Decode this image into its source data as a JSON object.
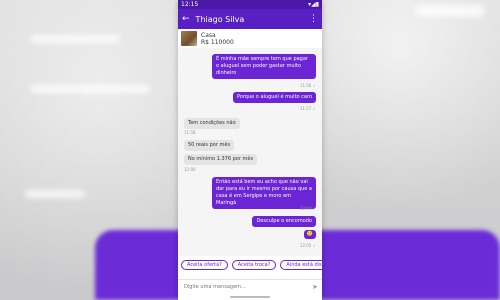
{
  "status": {
    "time": "12:15"
  },
  "header": {
    "contact": "Thiago  Silva"
  },
  "listing": {
    "title": "Casa",
    "price": "R$ 110000"
  },
  "messages": [
    {
      "text": "É minha mãe sempre tem que pagar o aluguel sem poder gastar muito dinheiro",
      "time": "11:56"
    },
    {
      "text": "Porque o aluguel é muito caro",
      "time": "11:57"
    },
    {
      "text": "Tem condições não",
      "time": "11:58"
    },
    {
      "text": "50 reais por mês"
    },
    {
      "text": "No mínimo 1.376 por mês",
      "time": "12:00"
    },
    {
      "text": "Então está bem eu acho que não vai dar para eu ir mesmo por causa que a casa é em Sergipe e moro em Maringá",
      "time": "12:04"
    },
    {
      "text": "Desculpe o encomodo"
    },
    {
      "text": "🙁",
      "time": "12:05"
    }
  ],
  "quick_replies": [
    "Aceita oferta?",
    "Aceita troca?",
    "Ainda está dispo"
  ],
  "composer": {
    "placeholder": "Digite uma mensagem..."
  }
}
